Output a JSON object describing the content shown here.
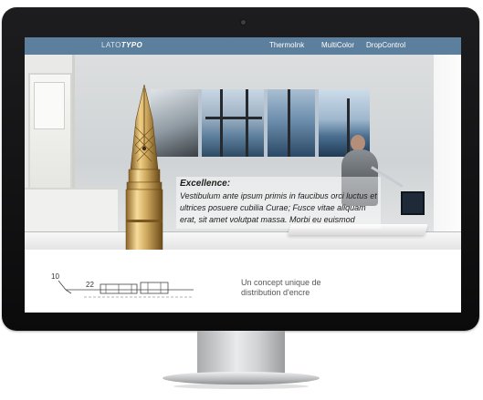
{
  "site": {
    "brand_plain": "LATO",
    "brand_accent": "TYPO",
    "nav_links": [
      {
        "label": "ThermoInk"
      },
      {
        "label": "MultiColor"
      },
      {
        "label": "DropControl"
      }
    ]
  },
  "hero": {
    "caption_title": "Excellence:",
    "caption_text": "Vestibulum ante ipsum primis in faucibus orci luctus et ultrices posuere cubilia Curae; Fusce vitae aliquam erat, sit amet volutpat massa. Morbi eu euismod"
  },
  "content": {
    "drawing_labels": [
      "10",
      "22"
    ],
    "concept_text": "Un concept unique de distribution d'encre"
  },
  "colors": {
    "navbar": "#5b7f9c",
    "bezel": "#111113",
    "pen_gold": "#c9a35a"
  },
  "icons": [
    "webcam-icon",
    "fountain-pen-nib-illustration"
  ]
}
